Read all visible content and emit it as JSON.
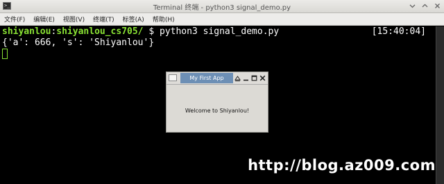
{
  "window": {
    "title": "Terminal 终端 - python3 signal_demo.py"
  },
  "menubar": {
    "items": [
      "文件(F)",
      "编辑(E)",
      "视图(V)",
      "终端(T)",
      "标签(A)",
      "帮助(H)"
    ]
  },
  "terminal": {
    "prompt_user": "shiyanlou",
    "prompt_colon": ":",
    "prompt_path": "shiyanlou_cs705/",
    "command": " $ python3 signal_demo.py",
    "timestamp": "[15:40:04]",
    "output": "{'a': 666, 's': 'Shiyanlou'}"
  },
  "app_window": {
    "title": "My First App",
    "message": "Welcome to Shiyanlou!"
  },
  "watermark": "http://blog.az009.com",
  "icons": {
    "terminal_app": "terminal-icon",
    "minimize": "minimize-icon",
    "maximize": "maximize-icon",
    "close": "close-icon",
    "shade": "shade-icon"
  },
  "colors": {
    "prompt_green": "#8ae234",
    "terminal_bg": "#000000",
    "app_title_blue": "#6d8fb5"
  }
}
